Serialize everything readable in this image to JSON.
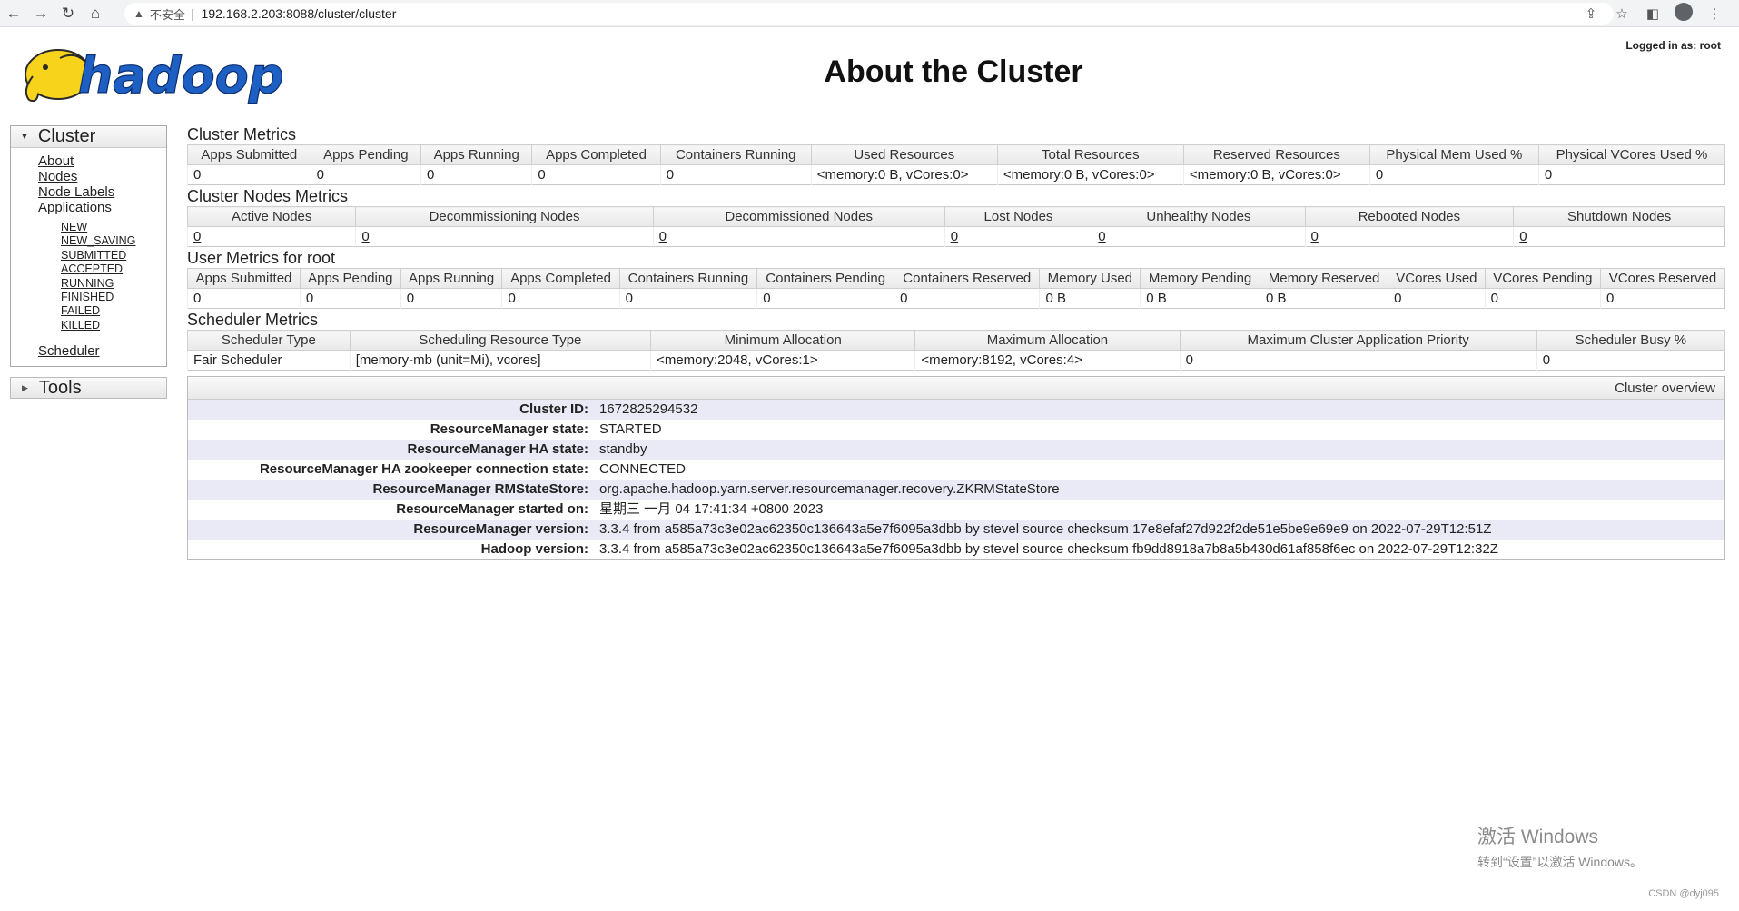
{
  "browser": {
    "insecure_label": "不安全",
    "url": "192.168.2.203:8088/cluster/cluster"
  },
  "header": {
    "logged_in": "Logged in as: root",
    "title": "About the Cluster",
    "logo_text": "hadoop"
  },
  "sidebar": {
    "cluster_label": "Cluster",
    "links": [
      "About",
      "Nodes",
      "Node Labels",
      "Applications"
    ],
    "app_states": [
      "NEW",
      "NEW_SAVING",
      "SUBMITTED",
      "ACCEPTED",
      "RUNNING",
      "FINISHED",
      "FAILED",
      "KILLED"
    ],
    "scheduler_label": "Scheduler",
    "tools_label": "Tools"
  },
  "cluster_metrics": {
    "title": "Cluster Metrics",
    "headers": [
      "Apps Submitted",
      "Apps Pending",
      "Apps Running",
      "Apps Completed",
      "Containers Running",
      "Used Resources",
      "Total Resources",
      "Reserved Resources",
      "Physical Mem Used %",
      "Physical VCores Used %"
    ],
    "values": [
      "0",
      "0",
      "0",
      "0",
      "0",
      "<memory:0 B, vCores:0>",
      "<memory:0 B, vCores:0>",
      "<memory:0 B, vCores:0>",
      "0",
      "0"
    ]
  },
  "nodes_metrics": {
    "title": "Cluster Nodes Metrics",
    "headers": [
      "Active Nodes",
      "Decommissioning Nodes",
      "Decommissioned Nodes",
      "Lost Nodes",
      "Unhealthy Nodes",
      "Rebooted Nodes",
      "Shutdown Nodes"
    ],
    "values": [
      "0",
      "0",
      "0",
      "0",
      "0",
      "0",
      "0"
    ]
  },
  "user_metrics": {
    "title": "User Metrics for root",
    "headers": [
      "Apps Submitted",
      "Apps Pending",
      "Apps Running",
      "Apps Completed",
      "Containers Running",
      "Containers Pending",
      "Containers Reserved",
      "Memory Used",
      "Memory Pending",
      "Memory Reserved",
      "VCores Used",
      "VCores Pending",
      "VCores Reserved"
    ],
    "values": [
      "0",
      "0",
      "0",
      "0",
      "0",
      "0",
      "0",
      "0 B",
      "0 B",
      "0 B",
      "0",
      "0",
      "0"
    ]
  },
  "scheduler_metrics": {
    "title": "Scheduler Metrics",
    "headers": [
      "Scheduler Type",
      "Scheduling Resource Type",
      "Minimum Allocation",
      "Maximum Allocation",
      "Maximum Cluster Application Priority",
      "Scheduler Busy %"
    ],
    "values": [
      "Fair Scheduler",
      "[memory-mb (unit=Mi), vcores]",
      "<memory:2048, vCores:1>",
      "<memory:8192, vCores:4>",
      "0",
      "0"
    ]
  },
  "overview": {
    "title": "Cluster overview",
    "rows": [
      {
        "label": "Cluster ID:",
        "value": "1672825294532"
      },
      {
        "label": "ResourceManager state:",
        "value": "STARTED"
      },
      {
        "label": "ResourceManager HA state:",
        "value": "standby"
      },
      {
        "label": "ResourceManager HA zookeeper connection state:",
        "value": "CONNECTED"
      },
      {
        "label": "ResourceManager RMStateStore:",
        "value": "org.apache.hadoop.yarn.server.resourcemanager.recovery.ZKRMStateStore"
      },
      {
        "label": "ResourceManager started on:",
        "value": "星期三 一月 04 17:41:34 +0800 2023"
      },
      {
        "label": "ResourceManager version:",
        "value": "3.3.4 from a585a73c3e02ac62350c136643a5e7f6095a3dbb by stevel source checksum 17e8efaf27d922f2de51e5be9e69e9 on 2022-07-29T12:51Z"
      },
      {
        "label": "Hadoop version:",
        "value": "3.3.4 from a585a73c3e02ac62350c136643a5e7f6095a3dbb by stevel source checksum fb9dd8918a7b8a5b430d61af858f6ec on 2022-07-29T12:32Z"
      }
    ]
  },
  "watermark": {
    "line1": "激活 Windows",
    "line2": "转到“设置”以激活 Windows。"
  },
  "credit": "CSDN @dyj095",
  "colors": {
    "logo_fill": "#f7d31b",
    "logo_text": "#1e5fc4",
    "overview_stripe": "#eaeaf6"
  }
}
